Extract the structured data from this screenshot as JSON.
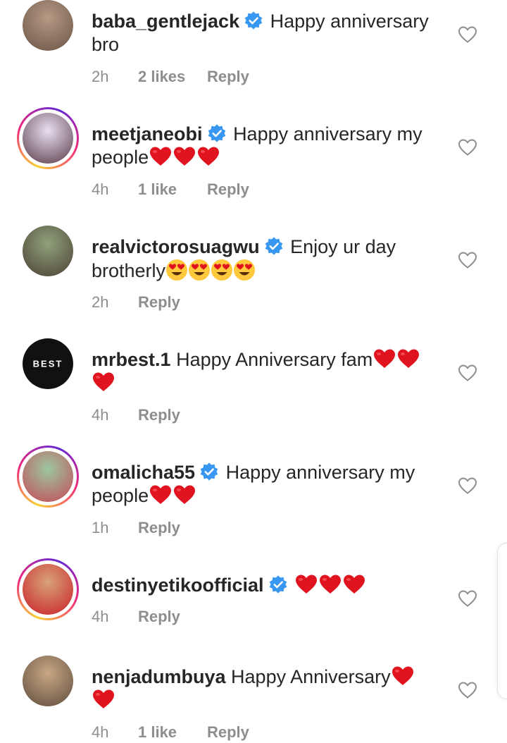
{
  "comments": [
    {
      "username": "baba_gentlejack",
      "verified": true,
      "text": "Happy anniversary bro",
      "hearts": 0,
      "faces": 0,
      "time": "2h",
      "likes": "2 likes",
      "reply": "Reply",
      "story_ring": false,
      "avatar_colors": [
        "#b59a84",
        "#6b5447"
      ],
      "avatar_text": ""
    },
    {
      "username": "meetjaneobi",
      "verified": true,
      "text": "Happy anniversary my people",
      "hearts": 3,
      "faces": 0,
      "time": "4h",
      "likes": "1 like",
      "reply": "Reply",
      "story_ring": true,
      "avatar_colors": [
        "#e7dff0",
        "#5a3b48"
      ],
      "avatar_text": ""
    },
    {
      "username": "realvictorosuagwu",
      "verified": true,
      "text": "Enjoy ur day brotherly",
      "hearts": 0,
      "faces": 4,
      "time": "2h",
      "likes": "",
      "reply": "Reply",
      "story_ring": false,
      "avatar_colors": [
        "#8fa27b",
        "#4c4034"
      ],
      "avatar_text": ""
    },
    {
      "username": "mrbest.1",
      "verified": false,
      "text": "Happy Anniversary fam",
      "hearts": 3,
      "faces": 0,
      "time": "4h",
      "likes": "",
      "reply": "Reply",
      "story_ring": false,
      "avatar_colors": [
        "#111111",
        "#111111"
      ],
      "avatar_text": "BEST"
    },
    {
      "username": "omalicha55",
      "verified": true,
      "text": "Happy anniversary my people",
      "hearts": 2,
      "faces": 0,
      "time": "1h",
      "likes": "",
      "reply": "Reply",
      "story_ring": true,
      "avatar_colors": [
        "#9cc7a0",
        "#c44a55"
      ],
      "avatar_text": ""
    },
    {
      "username": "destinyetikoofficial",
      "verified": true,
      "text": "",
      "hearts": 3,
      "faces": 0,
      "time": "4h",
      "likes": "",
      "reply": "Reply",
      "story_ring": true,
      "avatar_colors": [
        "#d8a277",
        "#c8202a"
      ],
      "avatar_text": ""
    },
    {
      "username": "nenjadumbuya",
      "verified": false,
      "text": "Happy Anniversary",
      "hearts": 2,
      "faces": 0,
      "time": "4h",
      "likes": "1 like",
      "reply": "Reply",
      "story_ring": false,
      "avatar_colors": [
        "#c9a783",
        "#5d4c3f"
      ],
      "avatar_text": ""
    }
  ],
  "icons": {
    "verified": "verified-badge-icon",
    "like": "heart-outline-icon",
    "heart_emoji": "red-heart-emoji",
    "face_emoji": "heart-eyes-emoji"
  },
  "colors": {
    "verified_blue": "#3897f0",
    "meta_gray": "#8e8e8e",
    "heart_red": "#e0141e",
    "face_yellow": "#ffc83d"
  }
}
